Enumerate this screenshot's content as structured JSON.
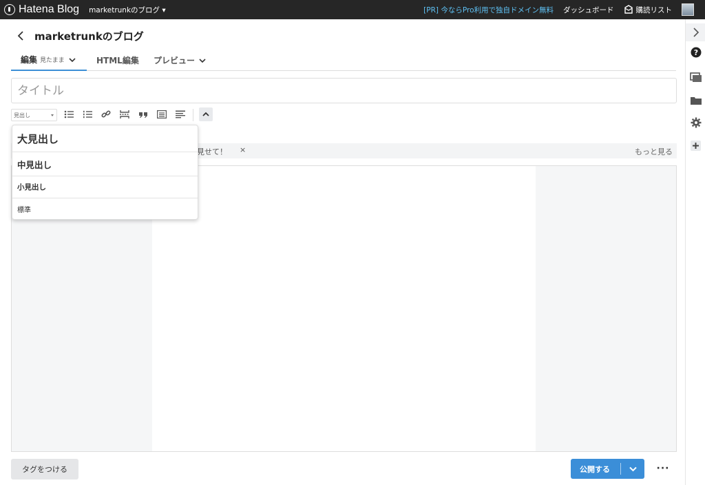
{
  "topbar": {
    "logo_text": "Hatena Blog",
    "blog_select": "marketrunkのブログ ▾",
    "pr_link": "[PR] 今ならPro利用で独自ドメイン無料",
    "dashboard": "ダッシュボード",
    "reader": "購読リスト"
  },
  "header": {
    "title": "marketrunkのブログ"
  },
  "tabs": [
    {
      "label": "編集",
      "sub": "見たまま"
    },
    {
      "label": "HTML編集"
    },
    {
      "label": "プレビュー"
    }
  ],
  "title_input": {
    "placeholder": "タイトル",
    "value": ""
  },
  "toolbar": {
    "heading_select": "見出し"
  },
  "heading_menu": {
    "items": [
      "大見出し",
      "中見出し",
      "小見出し",
      "標準"
    ]
  },
  "suggest": {
    "text": "見せて！",
    "close": "×",
    "more": "もっと見る"
  },
  "footer": {
    "tag_button": "タグをつける",
    "publish_button": "公開する",
    "more": "···"
  },
  "colors": {
    "topbar": "#262626",
    "accent": "#3b8ed8",
    "pr_link": "#5fc2f5"
  }
}
